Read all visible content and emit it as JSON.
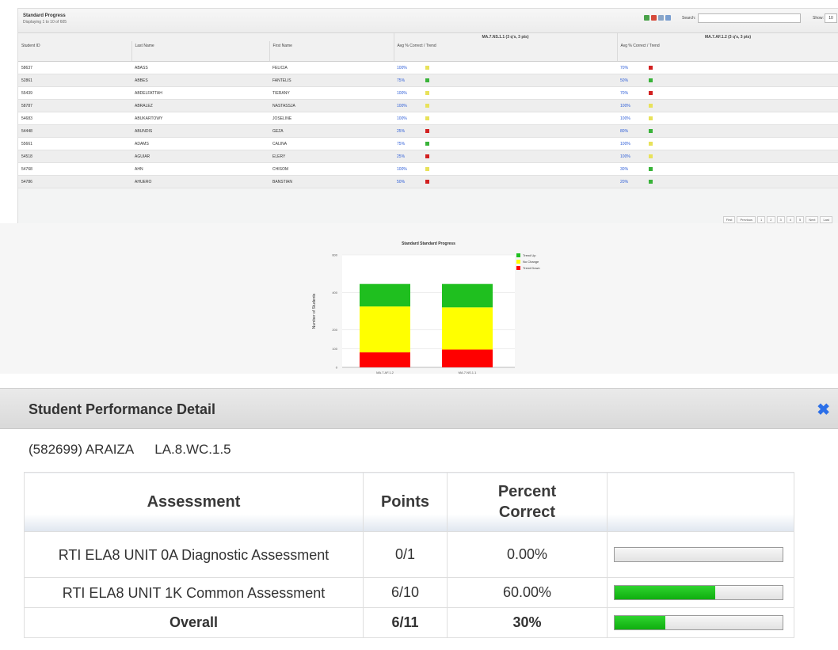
{
  "report": {
    "title": "Standard Progress",
    "subtitle": "Displaying 1 to 10 of 605",
    "search_label": "Search:",
    "show_label": "Show:",
    "show_value": "10",
    "group_headers": [
      "MA.7.NS.1.1 (3 q's, 3 pts)",
      "MA.7.AF.1.2 (3 q's, 3 pts)"
    ],
    "columns": [
      "Student ID",
      "Last Name",
      "First Name",
      "Avg % Correct / Trend",
      "Avg % Correct / Trend"
    ],
    "rows": [
      {
        "id": "58637",
        "last": "ABASS",
        "first": "FELICIA",
        "p1": "100%",
        "t1": "none",
        "p2": "70%",
        "t2": "down"
      },
      {
        "id": "52861",
        "last": "ABBES",
        "first": "FANTELIS",
        "p1": "75%",
        "t1": "up",
        "p2": "50%",
        "t2": "up"
      },
      {
        "id": "55439",
        "last": "ABDELFATTAH",
        "first": "TIERANY",
        "p1": "100%",
        "t1": "none",
        "p2": "70%",
        "t2": "down"
      },
      {
        "id": "58787",
        "last": "ABRALEZ",
        "first": "NASTASSJA",
        "p1": "100%",
        "t1": "none",
        "p2": "100%",
        "t2": "none"
      },
      {
        "id": "54683",
        "last": "ABUKARTOWY",
        "first": "JOSELINE",
        "p1": "100%",
        "t1": "none",
        "p2": "100%",
        "t2": "none"
      },
      {
        "id": "54448",
        "last": "ABUNDIS",
        "first": "GEZA",
        "p1": "25%",
        "t1": "down",
        "p2": "80%",
        "t2": "up"
      },
      {
        "id": "55661",
        "last": "ADAMS",
        "first": "CALINA",
        "p1": "75%",
        "t1": "up",
        "p2": "100%",
        "t2": "none"
      },
      {
        "id": "54518",
        "last": "AGUIAR",
        "first": "ELERY",
        "p1": "25%",
        "t1": "down",
        "p2": "100%",
        "t2": "none"
      },
      {
        "id": "54768",
        "last": "AHN",
        "first": "CHISOM",
        "p1": "100%",
        "t1": "none",
        "p2": "30%",
        "t2": "up"
      },
      {
        "id": "54786",
        "last": "AHUERO",
        "first": "BANSTIAN",
        "p1": "50%",
        "t1": "down",
        "p2": "20%",
        "t2": "up"
      }
    ],
    "pager": [
      "First",
      "Previous",
      "1",
      "2",
      "3",
      "4",
      "5",
      "Next",
      "Last"
    ]
  },
  "chart_data": {
    "type": "bar",
    "stacked": true,
    "title": "Standard Standard Progress",
    "ylabel": "Number of Students",
    "xlabel": "",
    "ylim": [
      0,
      600
    ],
    "yticks": [
      "0",
      "100",
      "200",
      "400",
      "600"
    ],
    "categories": [
      "MA.7.AF.1.2",
      "MA.7.NS.1.1"
    ],
    "series": [
      {
        "name": "Trend Down",
        "color": "#ff0000",
        "values": [
          80,
          95
        ]
      },
      {
        "name": "No Change",
        "color": "#ffff00",
        "values": [
          245,
          225
        ]
      },
      {
        "name": "Trend Up",
        "color": "#1fbf1f",
        "values": [
          120,
          125
        ]
      }
    ],
    "legend": [
      "Trend Up",
      "No Change",
      "Trend Down"
    ],
    "legend_position": "right"
  },
  "detail": {
    "title": "Student Performance Detail",
    "close_icon": "close-x-icon",
    "student": "(582699) ARAIZA",
    "standard": "LA.8.WC.1.5",
    "headers": {
      "assessment": "Assessment",
      "points": "Points",
      "percent": "Percent Correct"
    },
    "rows": [
      {
        "assessment": "RTI ELA8 UNIT 0A Diagnostic Assessment",
        "points": "0/1",
        "percent": "0.00%",
        "fill": 0.0
      },
      {
        "assessment": "RTI ELA8 UNIT 1K Common Assessment",
        "points": "6/10",
        "percent": "60.00%",
        "fill": 0.6
      }
    ],
    "overall": {
      "label": "Overall",
      "points": "6/11",
      "percent": "30%",
      "fill": 0.3
    }
  }
}
